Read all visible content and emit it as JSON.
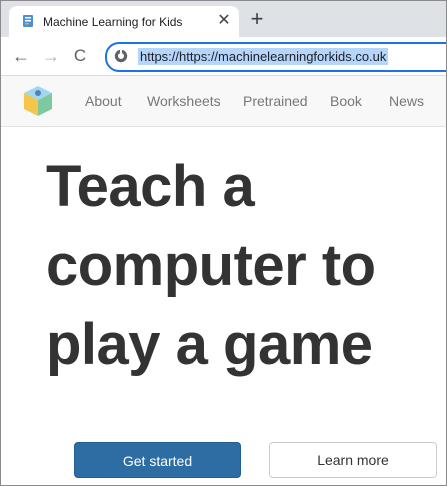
{
  "browser": {
    "tab": {
      "title": "Machine Learning for Kids",
      "close_glyph": "✕",
      "favicon": "document-icon"
    },
    "new_tab_glyph": "+",
    "toolbar": {
      "back_glyph": "←",
      "forward_glyph": "→",
      "reload_glyph": "C"
    },
    "address_bar": {
      "url": "https://https://machinelearningforkids.co.uk",
      "site_icon": "site-info-icon"
    },
    "accent_color": "#1a73e8"
  },
  "site": {
    "logo": "ml-cube-logo",
    "nav": [
      {
        "label": "About"
      },
      {
        "label": "Worksheets"
      },
      {
        "label": "Pretrained"
      },
      {
        "label": "Book"
      },
      {
        "label": "News"
      }
    ]
  },
  "hero": {
    "lines": [
      "Teach a",
      "computer to",
      "play a game"
    ]
  },
  "actions": {
    "primary": {
      "label": "Get started",
      "color": "#2e6da4"
    },
    "secondary": {
      "label": "Learn more"
    }
  }
}
